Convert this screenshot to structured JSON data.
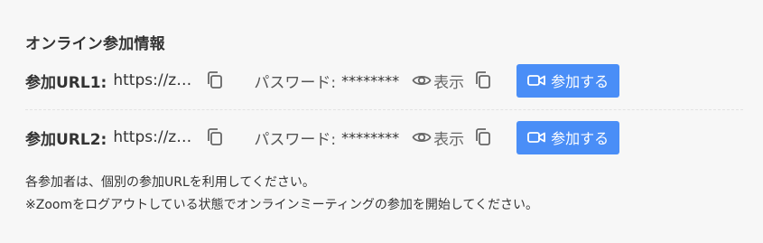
{
  "section": {
    "title": "オンライン参加情報"
  },
  "rows": [
    {
      "label": "参加URL1:",
      "url": "https://zo...",
      "password_label": "パスワード:",
      "password_value": "********",
      "show_label": "表示",
      "join_label": "参加する"
    },
    {
      "label": "参加URL2:",
      "url": "https://zo...",
      "password_label": "パスワード:",
      "password_value": "********",
      "show_label": "表示",
      "join_label": "参加する"
    }
  ],
  "notes": [
    "各参加者は、個別の参加URLを利用してください。",
    "※Zoomをログアウトしている状態でオンラインミーティングの参加を開始してください。"
  ],
  "colors": {
    "accent": "#4a8ef7",
    "background": "#f7f7f7",
    "text": "#333333"
  },
  "icons": {
    "copy": "copy-icon",
    "eye": "eye-icon",
    "camera": "video-camera-icon"
  }
}
